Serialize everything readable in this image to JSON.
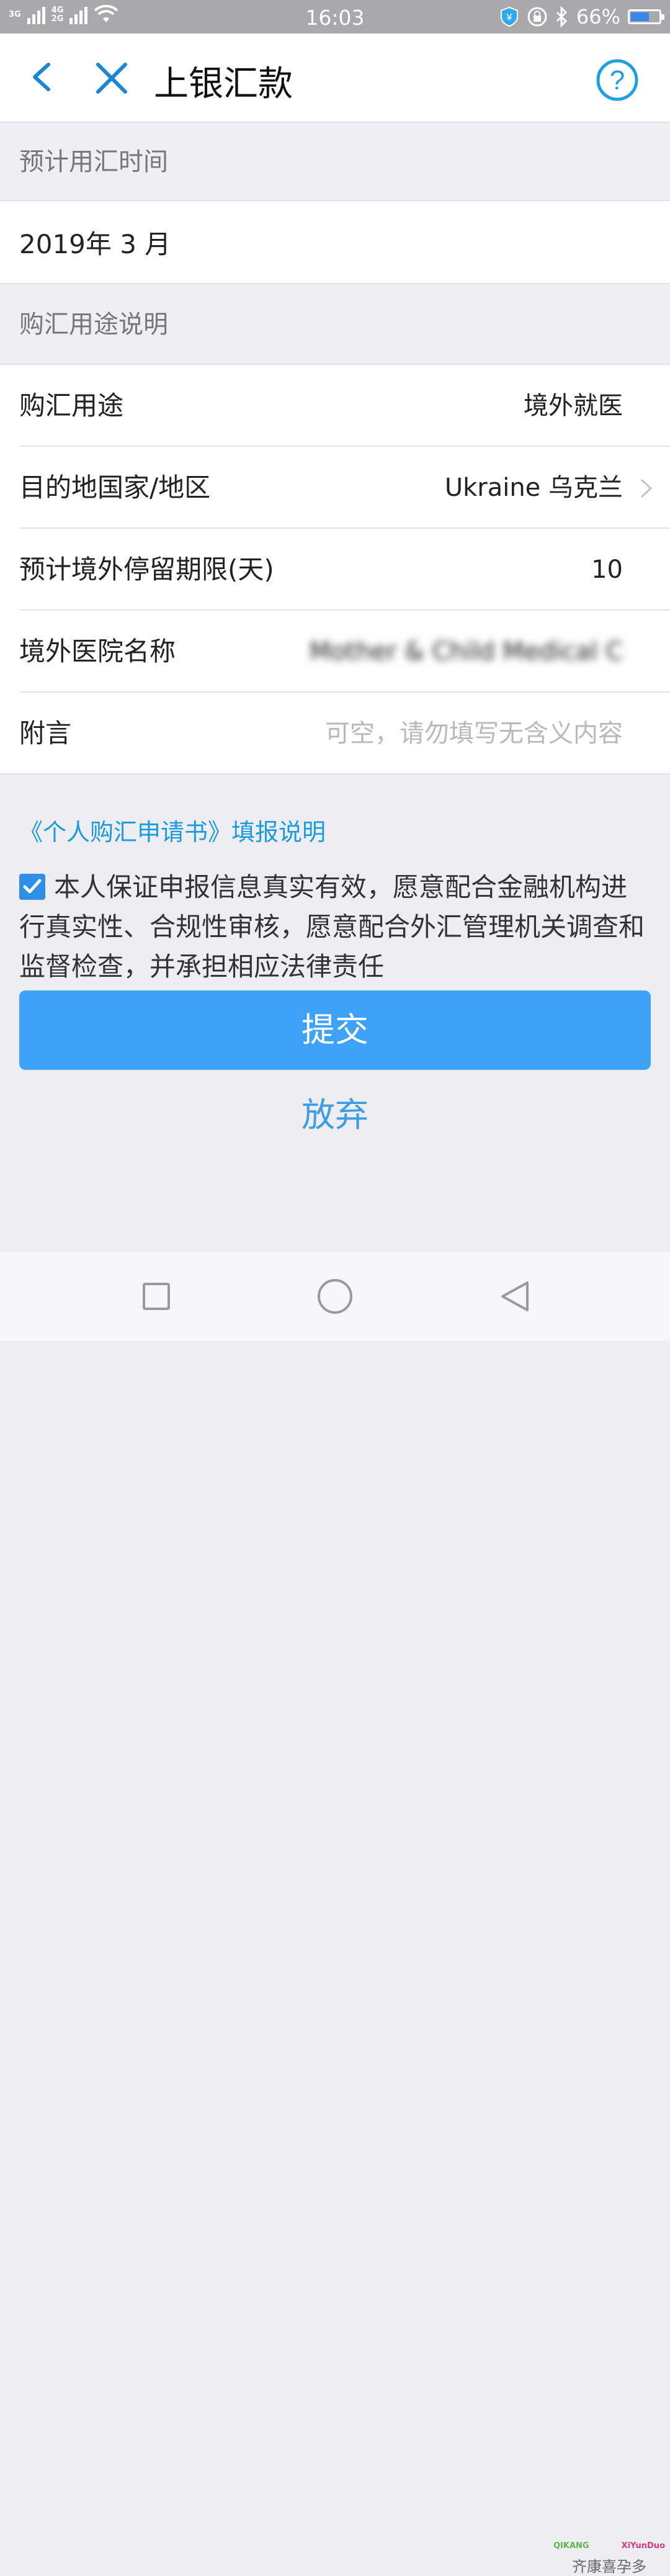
{
  "status_bar": {
    "network_top": "3G",
    "network_mid": "4G",
    "network_bottom": "2G",
    "time": "16:03",
    "battery_text": "66%",
    "battery_level": 0.66
  },
  "header": {
    "title": "上银汇款"
  },
  "sections": {
    "time_header": "预计用汇时间",
    "date_value": "2019年 3  月",
    "purpose_header": "购汇用途说明"
  },
  "rows": [
    {
      "label": "购汇用途",
      "value": "境外就医"
    },
    {
      "label": "目的地国家/地区",
      "value": "Ukraine 乌克兰"
    },
    {
      "label": "预计境外停留期限(天)",
      "value": "10"
    },
    {
      "label": "境外医院名称",
      "value": "Mother & Child Medical C"
    },
    {
      "label": "附言",
      "placeholder": "可空，请勿填写无含义内容"
    }
  ],
  "link_text": "《个人购汇申请书》填报说明",
  "agreement": {
    "checked": true,
    "text": "本人保证申报信息真实有效，愿意配合金融机构进行真实性、合规性审核，愿意配合外汇管理机关调查和监督检查，并承担相应法律责任"
  },
  "buttons": {
    "submit": "提交",
    "give_up": "放弃"
  },
  "watermark": {
    "left_brand": "QIKANG",
    "right_brand": "XiYunDuo",
    "chinese": "齐康喜孕多"
  },
  "colors": {
    "accent": "#3ea3f8",
    "link": "#1a9be0",
    "status_bar": "#a9a9ab"
  }
}
